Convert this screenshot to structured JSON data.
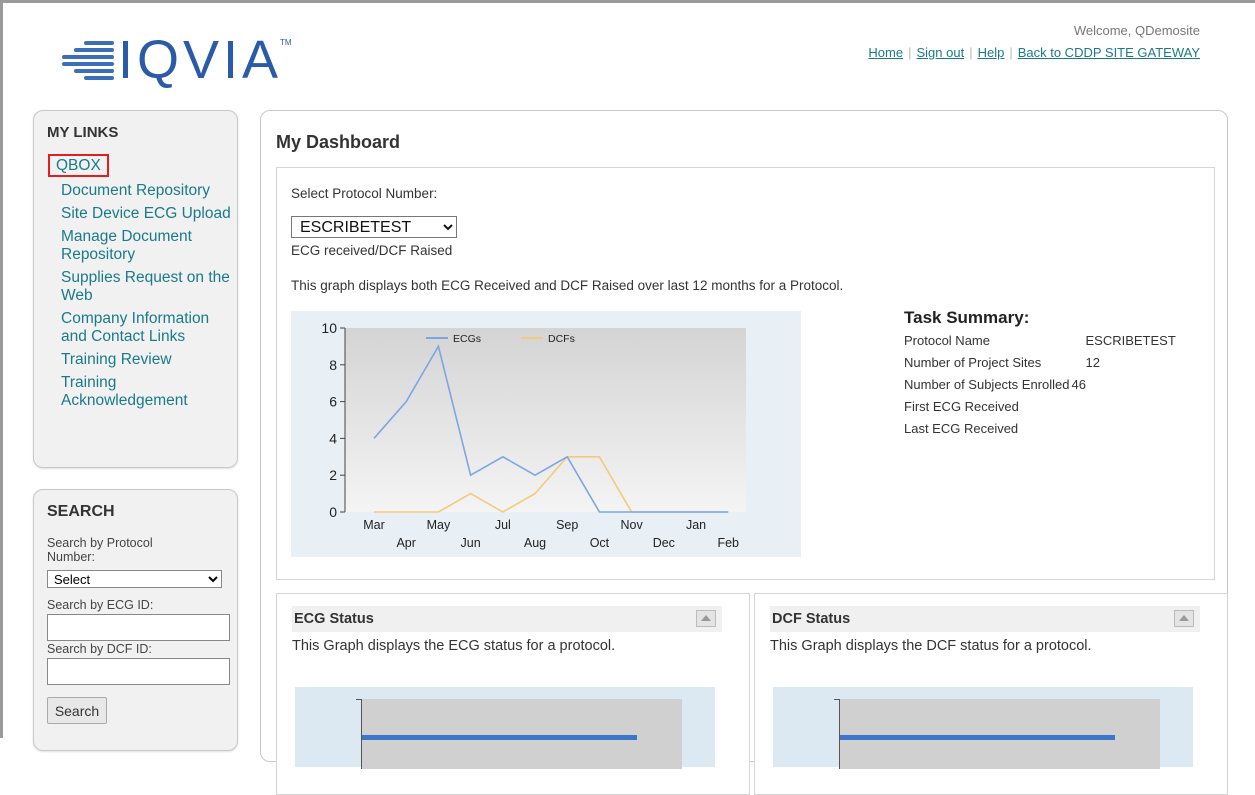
{
  "header": {
    "logo_text": "IQVIA",
    "logo_tm": "TM",
    "welcome": "Welcome, QDemosite",
    "links": [
      "Home",
      "Sign out",
      "Help",
      "Back to CDDP SITE GATEWAY"
    ]
  },
  "my_links": {
    "title": "MY LINKS",
    "items": [
      "QBOX",
      "Document Repository",
      "Site Device ECG Upload",
      "Manage Document Repository",
      "Supplies Request on the Web",
      "Company Information and Contact Links",
      "Training Review",
      "Training Acknowledgement"
    ]
  },
  "search": {
    "title": "SEARCH",
    "protocol_label": "Search by Protocol Number:",
    "protocol_value": "Select",
    "ecg_label": "Search by ECG ID:",
    "ecg_value": "",
    "dcf_label": "Search by DCF ID:",
    "dcf_value": "",
    "button": "Search"
  },
  "dashboard": {
    "title": "My Dashboard",
    "select_label": "Select Protocol Number:",
    "protocol_selected": "ESCRIBETEST",
    "chart_caption": "ECG received/DCF Raised",
    "description": "This graph displays both ECG Received and DCF Raised over last 12 months for a Protocol."
  },
  "task_summary": {
    "title": "Task Summary:",
    "rows": [
      {
        "label": "Protocol Name",
        "value": "ESCRIBETEST"
      },
      {
        "label": "Number of Project Sites",
        "value": "12"
      },
      {
        "label": "Number of Subjects Enrolled",
        "value": "46"
      },
      {
        "label": "First ECG Received",
        "value": ""
      },
      {
        "label": "Last ECG Received",
        "value": ""
      }
    ]
  },
  "ecg_status": {
    "title": "ECG Status",
    "description": "This Graph displays the ECG status for a protocol."
  },
  "dcf_status": {
    "title": "DCF Status",
    "description": "This Graph displays the DCF status for a protocol."
  },
  "colors": {
    "link": "#1a7a8a",
    "ecg_series": "#7aa6e6",
    "dcf_series": "#f5c97c",
    "highlight": "#e02020"
  },
  "chart_data": {
    "type": "line",
    "categories": [
      "Mar",
      "Apr",
      "May",
      "Jun",
      "Jul",
      "Aug",
      "Sep",
      "Oct",
      "Nov",
      "Dec",
      "Jan",
      "Feb"
    ],
    "series": [
      {
        "name": "ECGs",
        "values": [
          4,
          6,
          9,
          2,
          3,
          2,
          3,
          0,
          0,
          0,
          0,
          0
        ]
      },
      {
        "name": "DCFs",
        "values": [
          0,
          0,
          0,
          1,
          0,
          1,
          3,
          3,
          0,
          0,
          0,
          0
        ]
      }
    ],
    "ylim": [
      0,
      10
    ],
    "yticks": [
      0,
      2,
      4,
      6,
      8,
      10
    ],
    "legend": "top-center",
    "grid": false
  }
}
